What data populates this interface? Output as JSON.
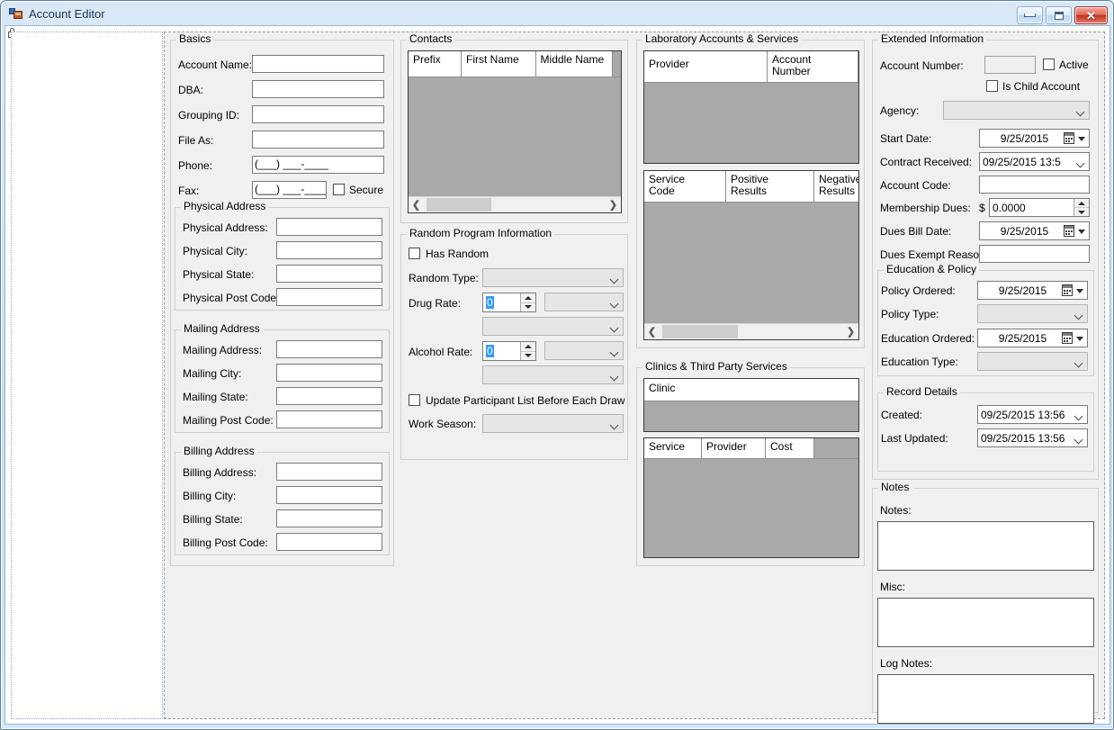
{
  "window": {
    "title": "Account Editor",
    "icon": "form-designer-icon",
    "buttons": {
      "minimize": "minimize-button",
      "maximize": "maximize-button",
      "close": "close-button",
      "close_glyph": "✕"
    }
  },
  "basics": {
    "legend": "Basics",
    "fields": [
      {
        "label": "Account Name:",
        "value": ""
      },
      {
        "label": "DBA:",
        "value": ""
      },
      {
        "label": "Grouping ID:",
        "value": ""
      },
      {
        "label": "File As:",
        "value": ""
      },
      {
        "label": "Phone:",
        "value": "(___)  ___-____"
      },
      {
        "label": "Fax:",
        "value": "(___)  ___-____"
      }
    ],
    "secure_checkbox": "Secure"
  },
  "physical_address": {
    "legend": "Physical Address",
    "fields": [
      {
        "label": "Physical Address:",
        "value": ""
      },
      {
        "label": "Physical City:",
        "value": ""
      },
      {
        "label": "Physical State:",
        "value": ""
      },
      {
        "label": "Physical Post Code:",
        "value": ""
      }
    ]
  },
  "mailing_address": {
    "legend": "Mailing Address",
    "fields": [
      {
        "label": "Mailing Address:",
        "value": ""
      },
      {
        "label": "Mailing City:",
        "value": ""
      },
      {
        "label": "Mailing State:",
        "value": ""
      },
      {
        "label": "Mailing Post Code:",
        "value": ""
      }
    ]
  },
  "billing_address": {
    "legend": "Billing Address",
    "fields": [
      {
        "label": "Billing Address:",
        "value": ""
      },
      {
        "label": "Billing City:",
        "value": ""
      },
      {
        "label": "Billing State:",
        "value": ""
      },
      {
        "label": "Billing Post Code:",
        "value": ""
      }
    ]
  },
  "contacts": {
    "legend": "Contacts",
    "columns": [
      "Prefix",
      "First Name",
      "Middle Name"
    ],
    "rows": []
  },
  "random_program": {
    "legend": "Random Program Information",
    "has_random_label": "Has Random",
    "random_type_label": "Random Type:",
    "random_type_value": "",
    "drug_rate_label": "Drug Rate:",
    "drug_rate_value": "0",
    "drug_rate_unit": "",
    "drug_rate_period": "",
    "alcohol_rate_label": "Alcohol Rate:",
    "alcohol_rate_value": "0",
    "alcohol_rate_unit": "",
    "alcohol_rate_period": "",
    "update_list_label": "Update Participant List Before Each Draw",
    "work_season_label": "Work Season:",
    "work_season_value": ""
  },
  "lab_accounts": {
    "legend": "Laboratory Accounts & Services",
    "providers_columns": [
      "Provider",
      "Account\nNumber"
    ],
    "providers_col1": "Provider",
    "providers_col2_line1": "Account",
    "providers_col2_line2": "Number",
    "services_col1_line1": "Service",
    "services_col1_line2": "Code",
    "services_col2_line1": "Positive",
    "services_col2_line2": "Results",
    "services_col3_line1": "Negative",
    "services_col3_line2": "Results",
    "rows": []
  },
  "clinics": {
    "legend": "Clinics & Third Party Services",
    "clinic_column": "Clinic",
    "service_columns": [
      "Service",
      "Provider",
      "Cost"
    ],
    "rows": []
  },
  "extended_information": {
    "legend": "Extended Information",
    "account_number_label": "Account Number:",
    "account_number_value": "",
    "active_label": "Active",
    "is_child_label": "Is Child Account",
    "agency_label": "Agency:",
    "agency_value": "",
    "start_date_label": "Start Date:",
    "start_date_value": "9/25/2015",
    "contract_received_label": "Contract Received:",
    "contract_received_value": "09/25/2015 13:5",
    "account_code_label": "Account Code:",
    "account_code_value": "",
    "membership_dues_label": "Membership Dues:",
    "membership_dues_currency": "$",
    "membership_dues_value": "0.0000",
    "dues_bill_date_label": "Dues Bill Date:",
    "dues_bill_date_value": "9/25/2015",
    "dues_exempt_label": "Dues Exempt Reason:",
    "dues_exempt_value": ""
  },
  "education_policy": {
    "legend": "Education & Policy",
    "policy_ordered_label": "Policy Ordered:",
    "policy_ordered_value": "9/25/2015",
    "policy_type_label": "Policy Type:",
    "policy_type_value": "",
    "education_ordered_label": "Education Ordered:",
    "education_ordered_value": "9/25/2015",
    "education_type_label": "Education Type:",
    "education_type_value": ""
  },
  "record_details": {
    "legend": "Record Details",
    "created_label": "Created:",
    "created_value": "09/25/2015 13:56",
    "last_updated_label": "Last Updated:",
    "last_updated_value": "09/25/2015 13:56"
  },
  "notes": {
    "legend": "Notes",
    "notes_label": "Notes:",
    "notes_value": "",
    "misc_label": "Misc:",
    "misc_value": "",
    "log_notes_label": "Log Notes:",
    "log_notes_value": ""
  },
  "colors": {
    "form_bg": "#f0f0f0",
    "grid_body": "#a9a9a9",
    "disabled_control": "#e6e6e6",
    "title_accent": "#c3daf2",
    "close_button": "#c3311f"
  }
}
